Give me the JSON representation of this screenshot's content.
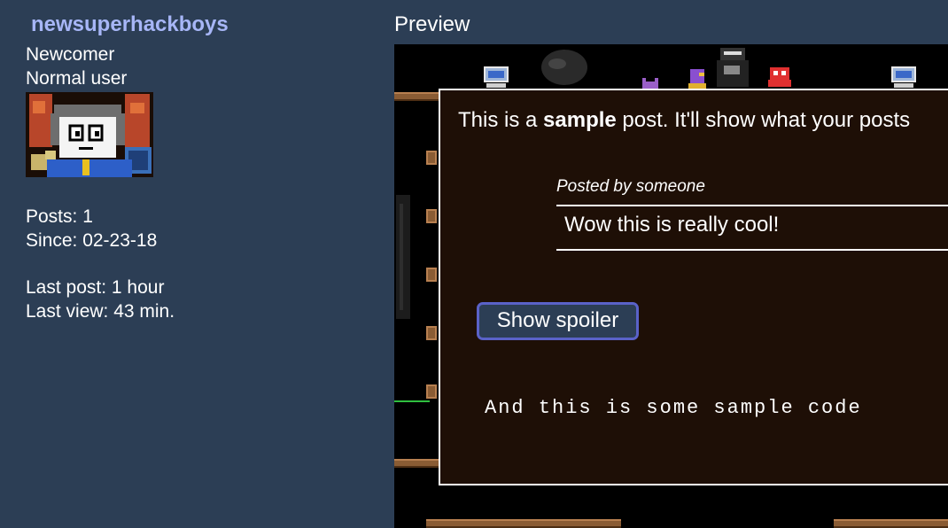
{
  "user": {
    "name": "newsuperhackboys",
    "rank": "Newcomer",
    "group": "Normal user",
    "posts": "Posts: 1",
    "since": "Since: 02-23-18",
    "last_post": "Last post: 1 hour",
    "last_view": "Last view: 43 min."
  },
  "preview": {
    "label": "Preview",
    "post_prefix": "This is a ",
    "post_bold": "sample",
    "post_suffix": " post. It'll show what your posts",
    "quote_author": "Posted by someone",
    "quote_text": "Wow this is really cool!",
    "spoiler_button": "Show spoiler",
    "code_text": "And this is some sample code"
  },
  "colors": {
    "background": "#2c3e55",
    "username": "#a7b6f7",
    "post_bg": "#1e0f06",
    "spoiler_border": "#5a62c8"
  }
}
